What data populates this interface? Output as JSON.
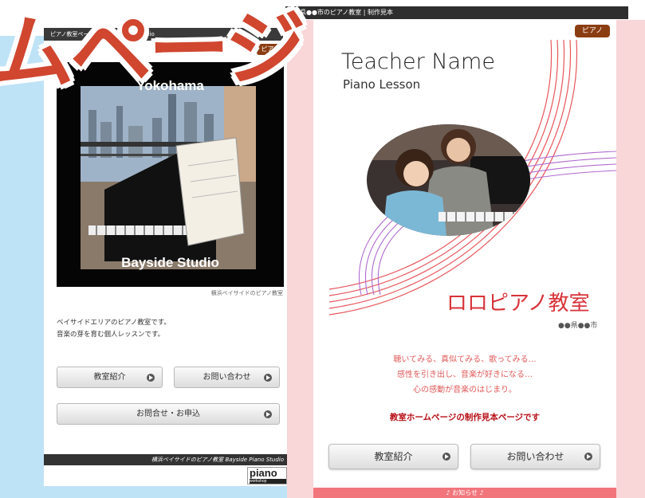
{
  "overlay_title": "ムページ",
  "left_site": {
    "top_bar_text": "ピアノ教室ページ Bayside Piano Studio",
    "tag": "ピアノ",
    "photo_title_top": "Yokohama",
    "photo_title_bottom": "Bayside Studio",
    "photo_caption": "横浜ベイサイドのピアノ教室",
    "intro_line1": "ベイサイドエリアのピアノ教室です。",
    "intro_line2": "音楽の芽を育む個人レッスンです。",
    "buttons": {
      "about": "教室紹介",
      "contact": "お問い合わせ",
      "apply": "お問合せ・お申込"
    },
    "footer_text": "横浜ベイサイドのピアノ教室 Bayside Piano Studio",
    "logo_text": "piano",
    "logo_sub": "workshop"
  },
  "right_site": {
    "top_bar_text": "●●県●●市のピアノ教室 | 制作見本",
    "tag": "ピアノ",
    "teacher_name": "Teacher Name",
    "lesson_label": "Piano Lesson",
    "school_name": "ロロピアノ教室",
    "city": "●●県●●市",
    "catch_line1": "聴いてみる、真似てみる、歌ってみる…",
    "catch_line2": "感性を引き出し、音楽が好きになる…",
    "catch_line3": "心の感動が音楽のはじまり。",
    "sample_notice": "教室ホームページの制作見本ページです",
    "buttons": {
      "about": "教室紹介",
      "contact": "お問い合わせ"
    },
    "bottom_bar_text": "♪ お知らせ ♪"
  },
  "colors": {
    "accent_red": "#d0462f",
    "tag_brown": "#8b3d12",
    "school_red": "#d8333a",
    "pink_bg": "#f9d6d8",
    "blue_bg": "#bfe3f6"
  }
}
